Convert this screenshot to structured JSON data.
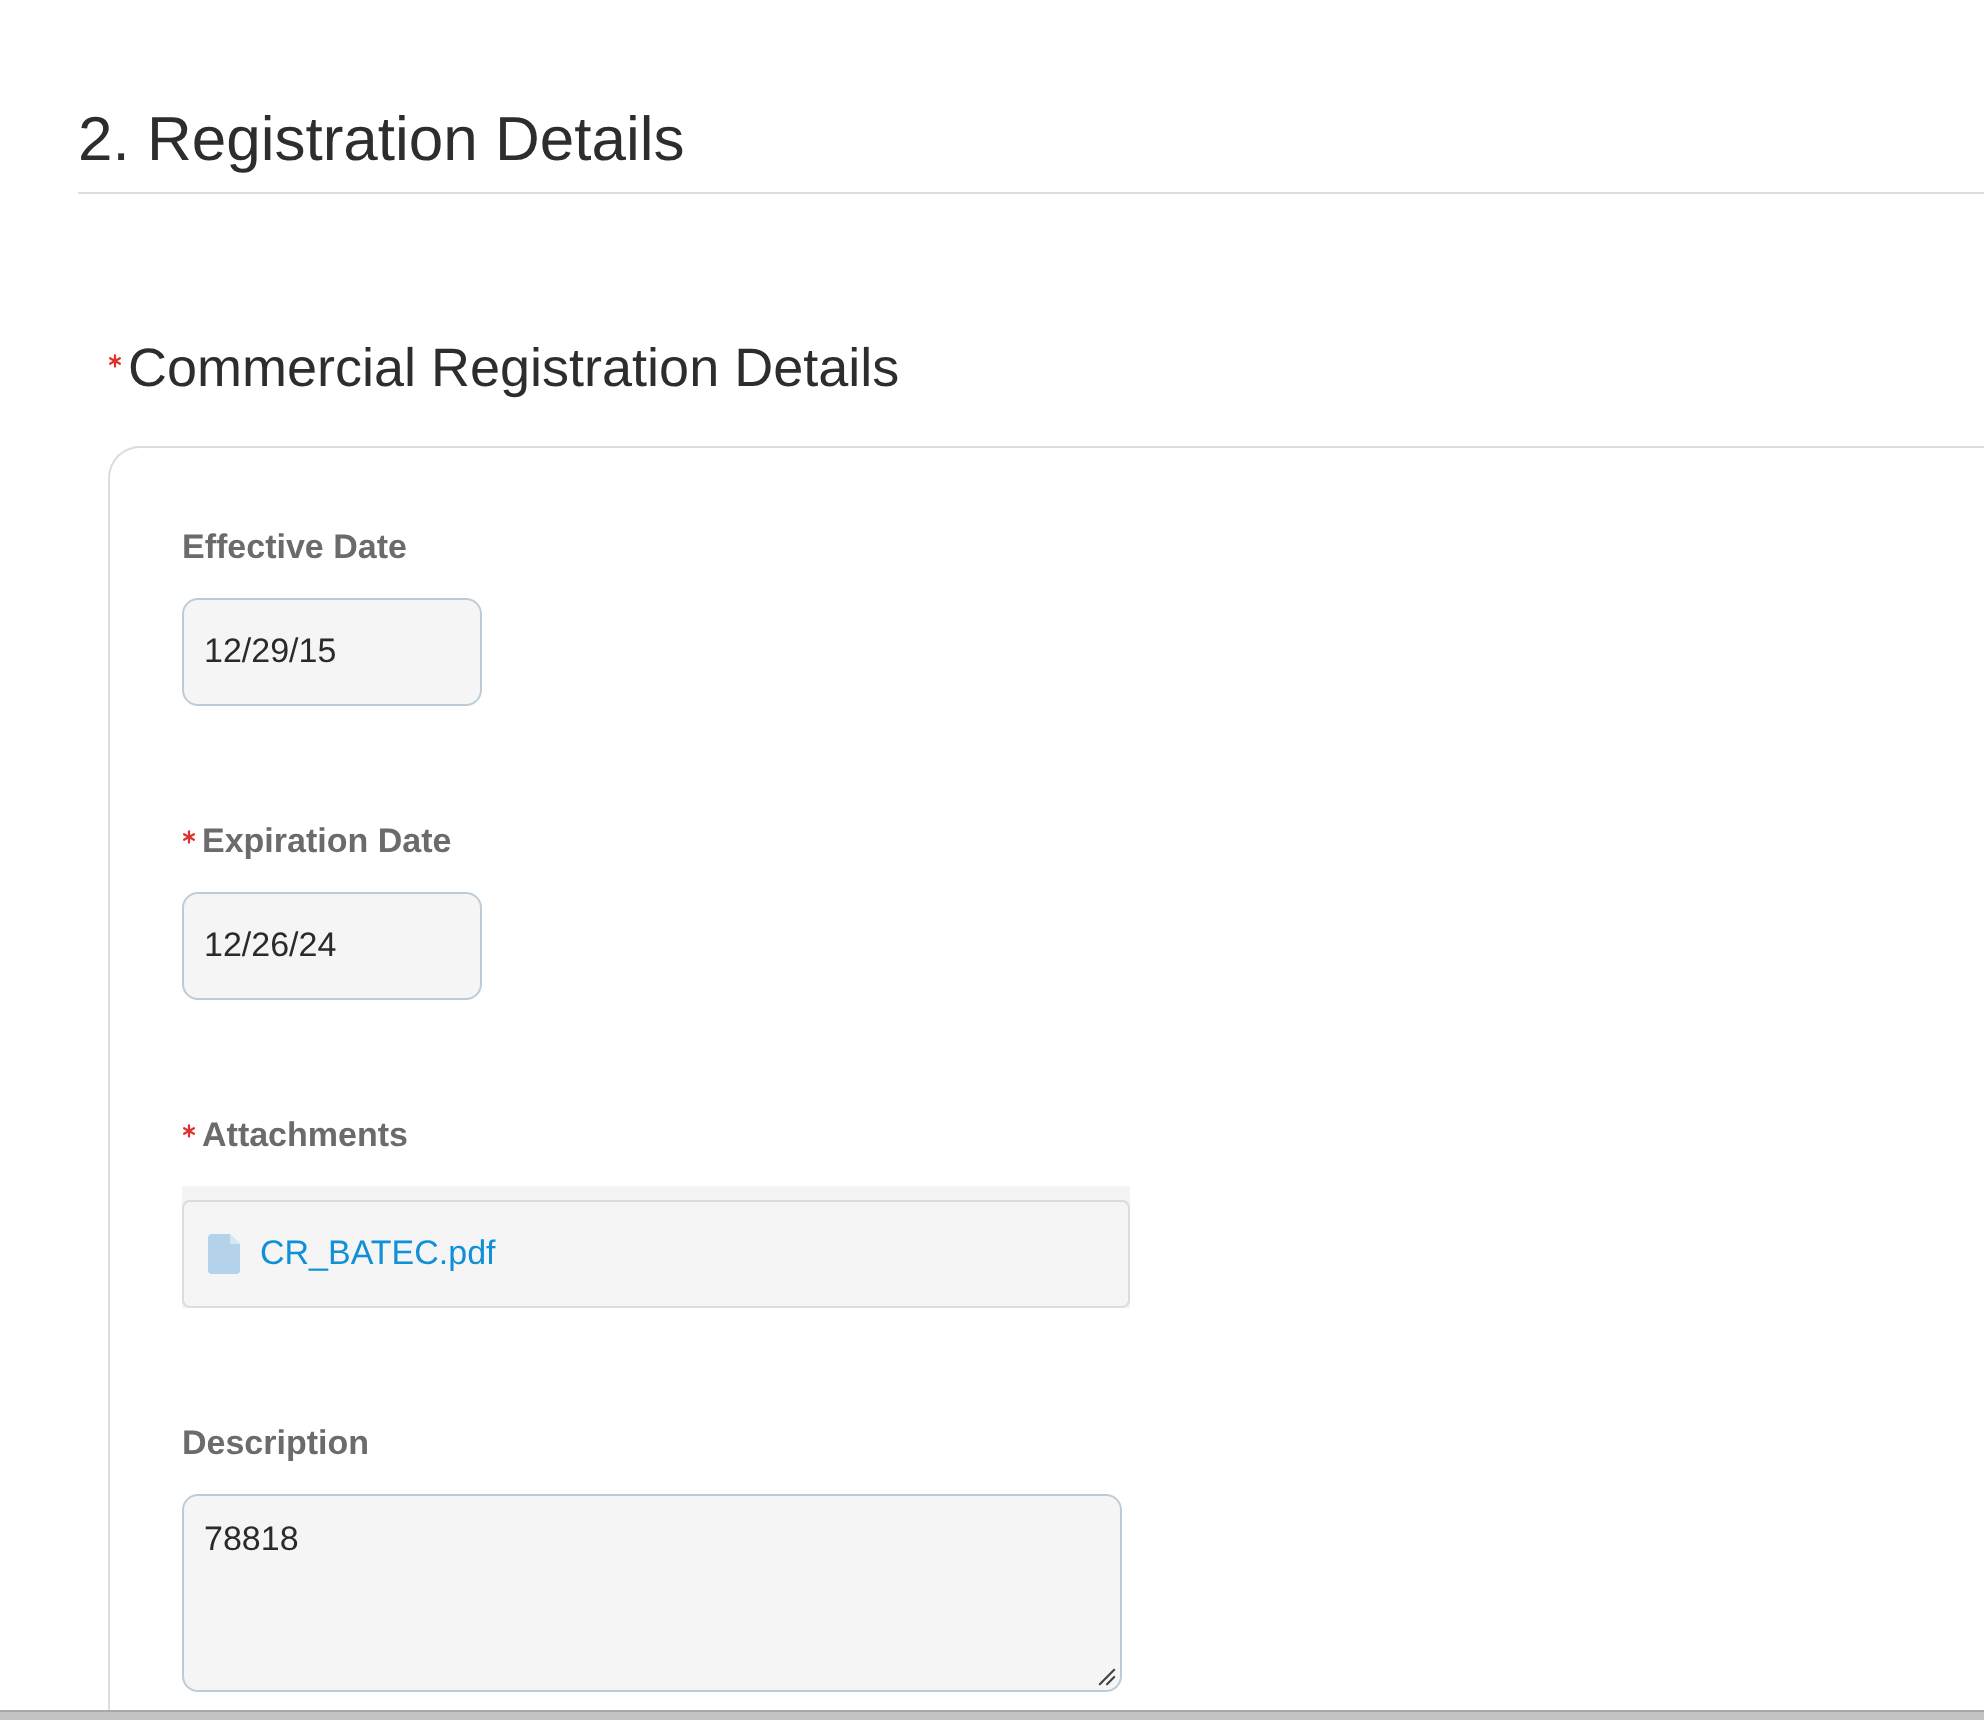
{
  "section": {
    "title": "2. Registration Details"
  },
  "subsection": {
    "title": "Commercial Registration Details",
    "required": true
  },
  "fields": [
    {
      "kind": "date",
      "label": "Effective Date",
      "required": false,
      "value": "12/29/15"
    },
    {
      "kind": "date",
      "label": "Expiration Date",
      "required": true,
      "value": "12/26/24"
    },
    {
      "kind": "attachments",
      "label": "Attachments",
      "required": true,
      "files": [
        "CR_BATEC.pdf"
      ]
    },
    {
      "kind": "textarea",
      "label": "Description",
      "required": false,
      "value": "78818"
    }
  ]
}
